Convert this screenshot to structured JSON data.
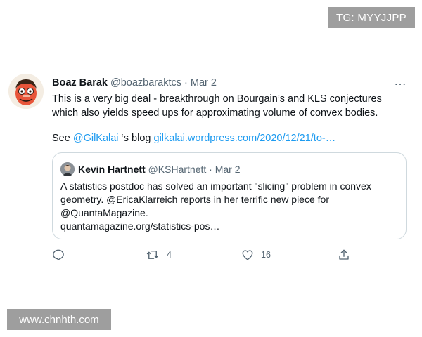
{
  "overlay": {
    "tg_badge": "TG: MYYJJPP",
    "watermark": "www.chnhth.com"
  },
  "tweet": {
    "author_name": "Boaz Barak",
    "author_handle": "@boazbaraktcs",
    "separator": "·",
    "date": "Mar 2",
    "text_line_1": "This is a very big deal - breakthrough on Bourgain’s and KLS conjectures",
    "text_line_2": "which also yields speed ups for approximating volume of convex bodies.",
    "see_prefix": "See ",
    "mention": "@GilKalai",
    "see_middle": " ‘s blog ",
    "blog_link": "gilkalai.wordpress.com/2020/12/21/to-…",
    "more_icon": "…"
  },
  "quoted": {
    "author_name": "Kevin Hartnett",
    "author_handle": "@KSHartnett",
    "separator": "·",
    "date": "Mar 2",
    "line_1": "A statistics postdoc has solved an important \"slicing\" problem in convex",
    "line_2": "geometry. @EricaKlarreich reports in her terrific new piece for",
    "line_3": "@QuantaMagazine.",
    "line_4": "quantamagazine.org/statistics-pos…"
  },
  "actions": {
    "reply_icon": "reply-icon",
    "retweet_icon": "retweet-icon",
    "retweet_count": "4",
    "like_icon": "heart-icon",
    "like_count": "16",
    "share_icon": "share-icon"
  },
  "colors": {
    "link": "#1d9bf0",
    "muted": "#536471",
    "border": "#cfd9de"
  }
}
